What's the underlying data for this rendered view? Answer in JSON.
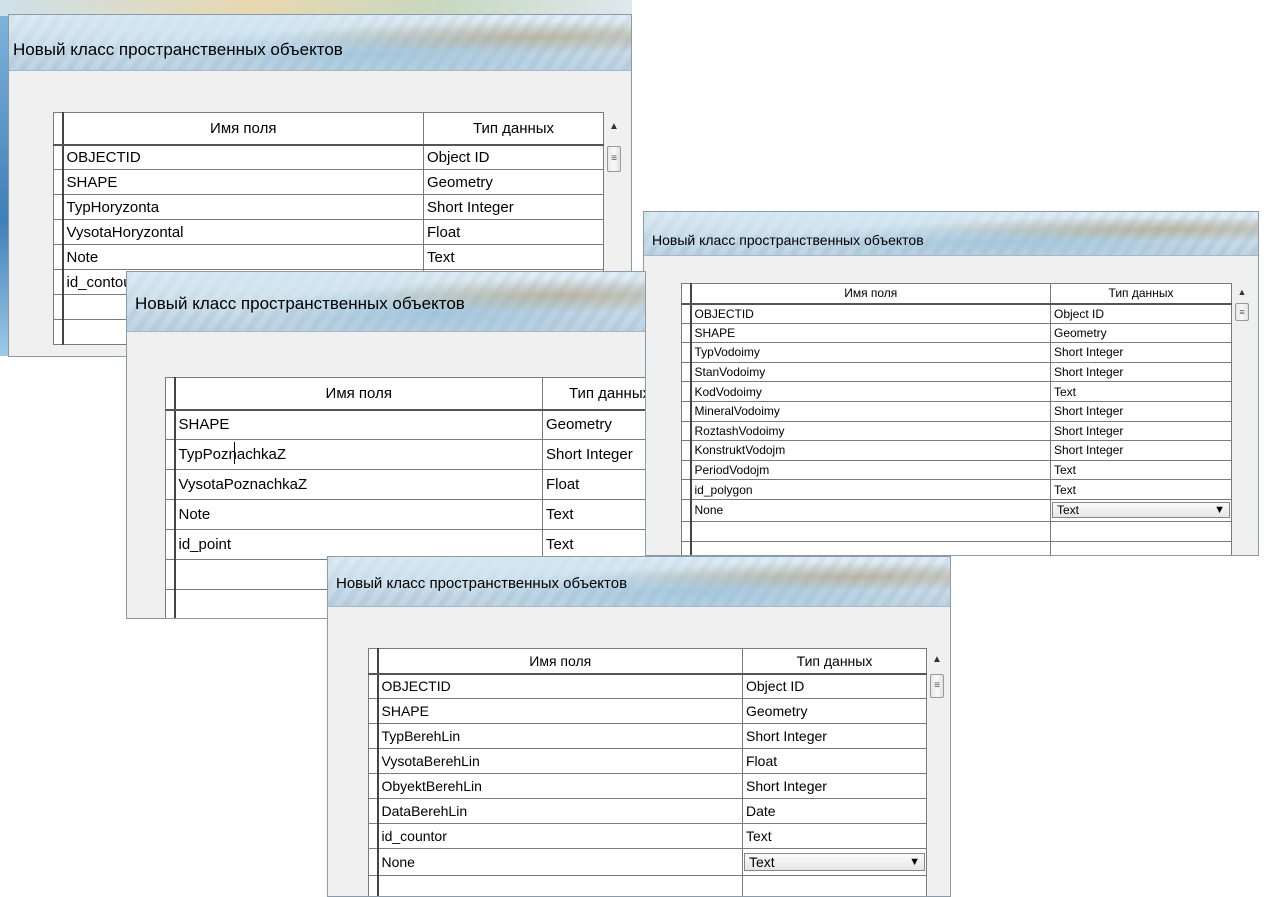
{
  "windows": {
    "w1": {
      "title": "Новый класс пространственных объектов",
      "header": {
        "name": "Имя поля",
        "type": "Тип данных"
      },
      "rows": [
        {
          "name": "OBJECTID",
          "type": "Object ID"
        },
        {
          "name": "SHAPE",
          "type": "Geometry"
        },
        {
          "name": "TypHoryzonta",
          "type": "Short Integer"
        },
        {
          "name": "VysotaHoryzontal",
          "type": "Float"
        },
        {
          "name": "Note",
          "type": "Text"
        },
        {
          "name": "id_contour",
          "type": ""
        }
      ]
    },
    "w2": {
      "title": "Новый класс пространственных объектов",
      "header": {
        "name": "Имя поля",
        "type": "Тип данных"
      },
      "rows": [
        {
          "name": "SHAPE",
          "type": "Geometry"
        },
        {
          "name": "TypPoznachkaZ",
          "type": "Short Integer"
        },
        {
          "name": "VysotaPoznachkaZ",
          "type": "Float"
        },
        {
          "name": "Note",
          "type": "Text"
        },
        {
          "name": "id_point",
          "type": "Text"
        }
      ]
    },
    "w3": {
      "title": "Новый класс пространственных объектов",
      "header": {
        "name": "Имя поля",
        "type": "Тип данных"
      },
      "rows": [
        {
          "name": "OBJECTID",
          "type": "Object ID"
        },
        {
          "name": "SHAPE",
          "type": "Geometry"
        },
        {
          "name": "TypVodoimy",
          "type": "Short Integer"
        },
        {
          "name": "StanVodoimy",
          "type": "Short Integer"
        },
        {
          "name": "KodVodoimy",
          "type": "Text"
        },
        {
          "name": "MineralVodoimy",
          "type": "Short Integer"
        },
        {
          "name": "RoztashVodoimy",
          "type": "Short Integer"
        },
        {
          "name": "KonstruktVodojm",
          "type": "Short Integer"
        },
        {
          "name": "PeriodVodojm",
          "type": "Text"
        },
        {
          "name": "id_polygon",
          "type": "Text"
        },
        {
          "name": "None",
          "type": "Text"
        }
      ]
    },
    "w4": {
      "title": "Новый класс пространственных объектов",
      "header": {
        "name": "Имя поля",
        "type": "Тип данных"
      },
      "rows": [
        {
          "name": "OBJECTID",
          "type": "Object ID"
        },
        {
          "name": "SHAPE",
          "type": "Geometry"
        },
        {
          "name": "TypBerehLin",
          "type": "Short Integer"
        },
        {
          "name": "VysotaBerehLin",
          "type": "Float"
        },
        {
          "name": "ObyektBerehLin",
          "type": "Short Integer"
        },
        {
          "name": "DataBerehLin",
          "type": "Date"
        },
        {
          "name": "id_countor",
          "type": "Text"
        },
        {
          "name": "None",
          "type": "Text"
        }
      ]
    }
  },
  "icons": {
    "scroll_up": "scroll-up-arrow-icon",
    "dropdown": "dropdown-arrow-icon",
    "grip": "scrollbar-grip-icon"
  },
  "colors": {
    "dialog_bg": "#f0f0f0",
    "grid_border": "#7a7a7a",
    "title_glass": "#c8dbe8"
  }
}
